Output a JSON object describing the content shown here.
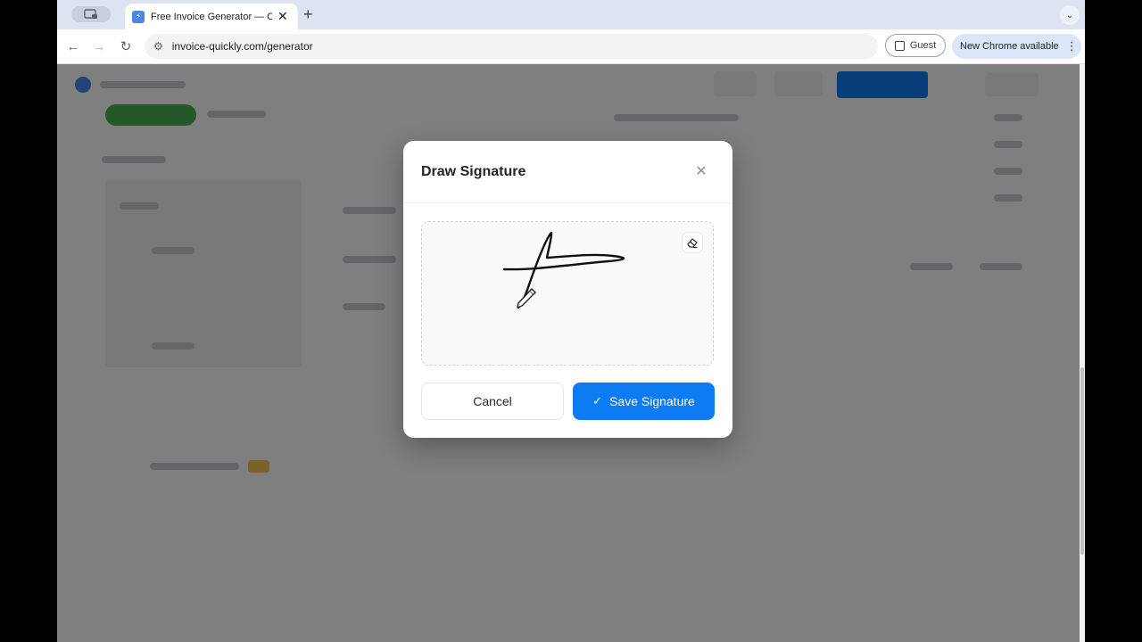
{
  "browser": {
    "tab_title": "Free Invoice Generator — Cre",
    "url": "invoice-quickly.com/generator",
    "profile_label": "Guest",
    "update_label": "New Chrome available"
  },
  "modal": {
    "title": "Draw Signature",
    "cancel_label": "Cancel",
    "save_label": "Save Signature"
  },
  "icons": {
    "close": "close-icon",
    "eraser": "eraser-icon",
    "pen": "pen-icon",
    "check": "check-icon"
  },
  "colors": {
    "primary": "#0d7cf2",
    "tab_strip": "#dde3f1"
  }
}
